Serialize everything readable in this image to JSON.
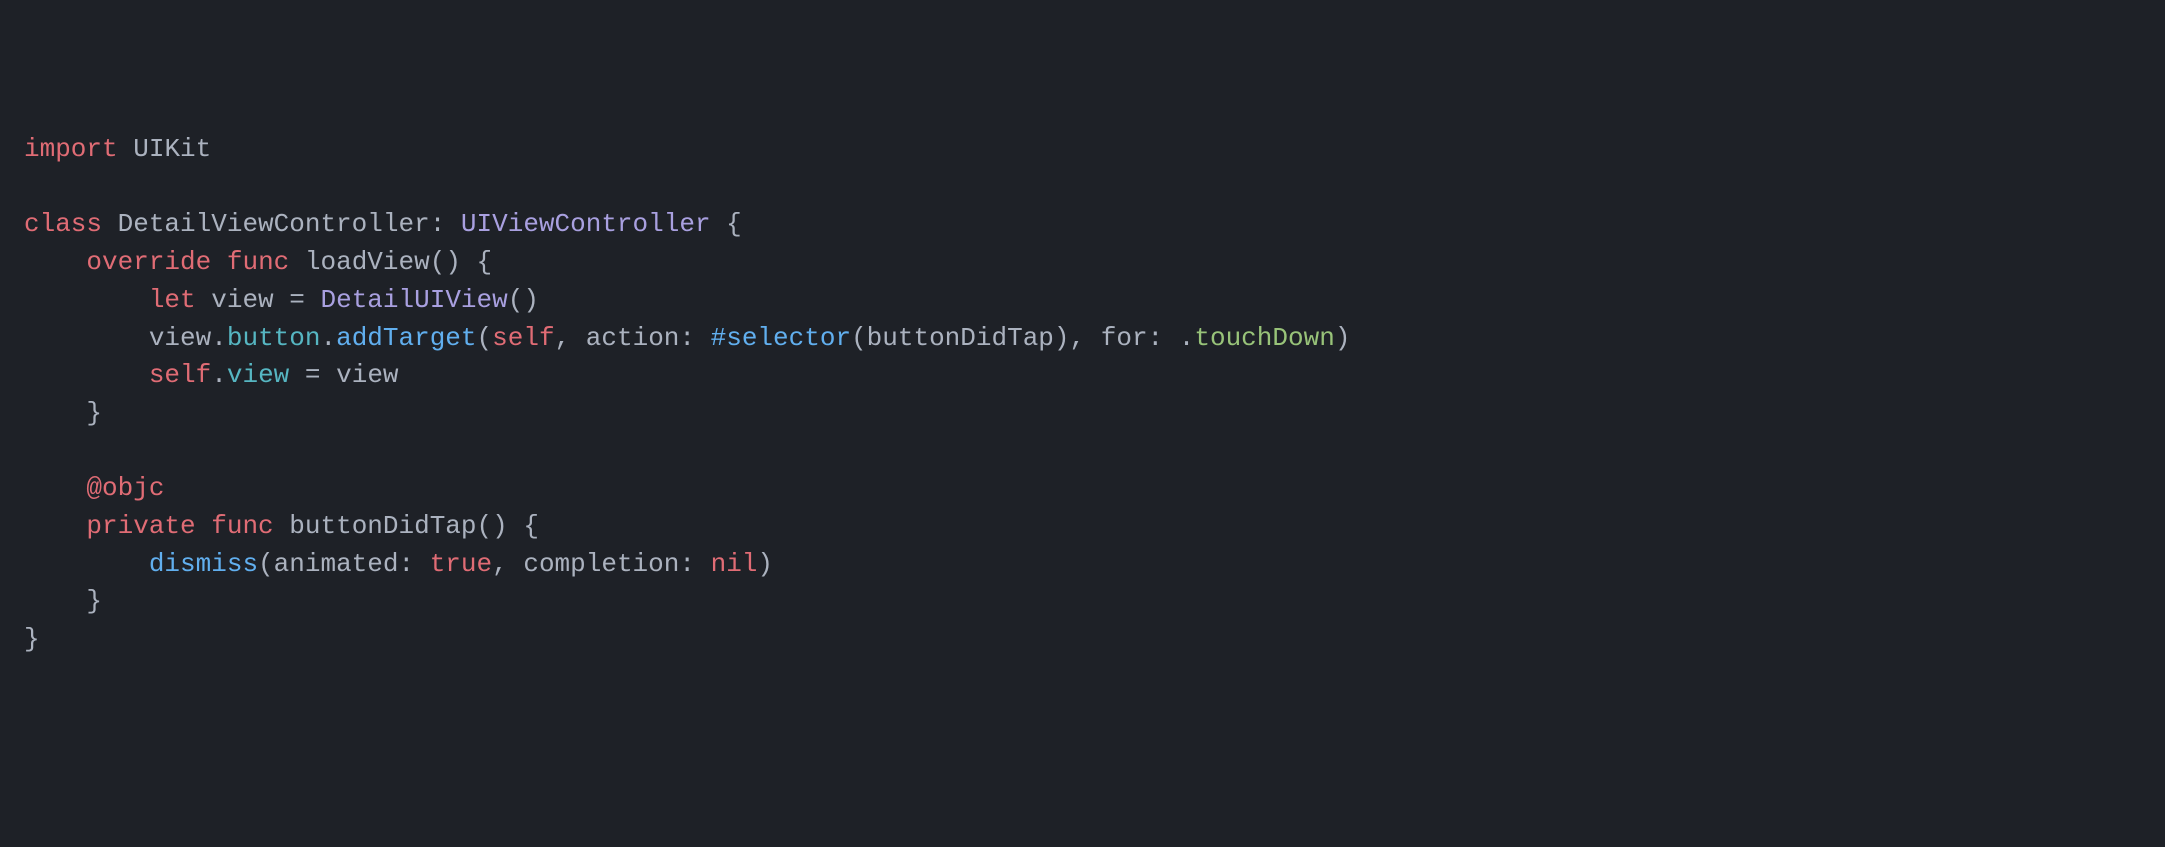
{
  "code": {
    "tokens": {
      "import": "import",
      "uikit": "UIKit",
      "class": "class",
      "className": "DetailViewController",
      "colon1": ":",
      "superclass": "UIViewController",
      "override": "override",
      "func": "func",
      "loadView": "loadView",
      "let": "let",
      "viewVar": "view",
      "equals": "=",
      "detailUIView": "DetailUIView",
      "button": "button",
      "addTarget": "addTarget",
      "self": "self",
      "actionLabel": "action",
      "selector": "#selector",
      "buttonDidTap": "buttonDidTap",
      "forLabel": "for",
      "touchDown": "touchDown",
      "objc": "@objc",
      "private": "private",
      "dismiss": "dismiss",
      "animatedLabel": "animated",
      "trueVal": "true",
      "completionLabel": "completion",
      "nilVal": "nil",
      "dot": ".",
      "comma": ",",
      "openParen": "(",
      "closeParen": ")",
      "openBrace": "{",
      "closeBrace": "}",
      "space": " "
    }
  }
}
